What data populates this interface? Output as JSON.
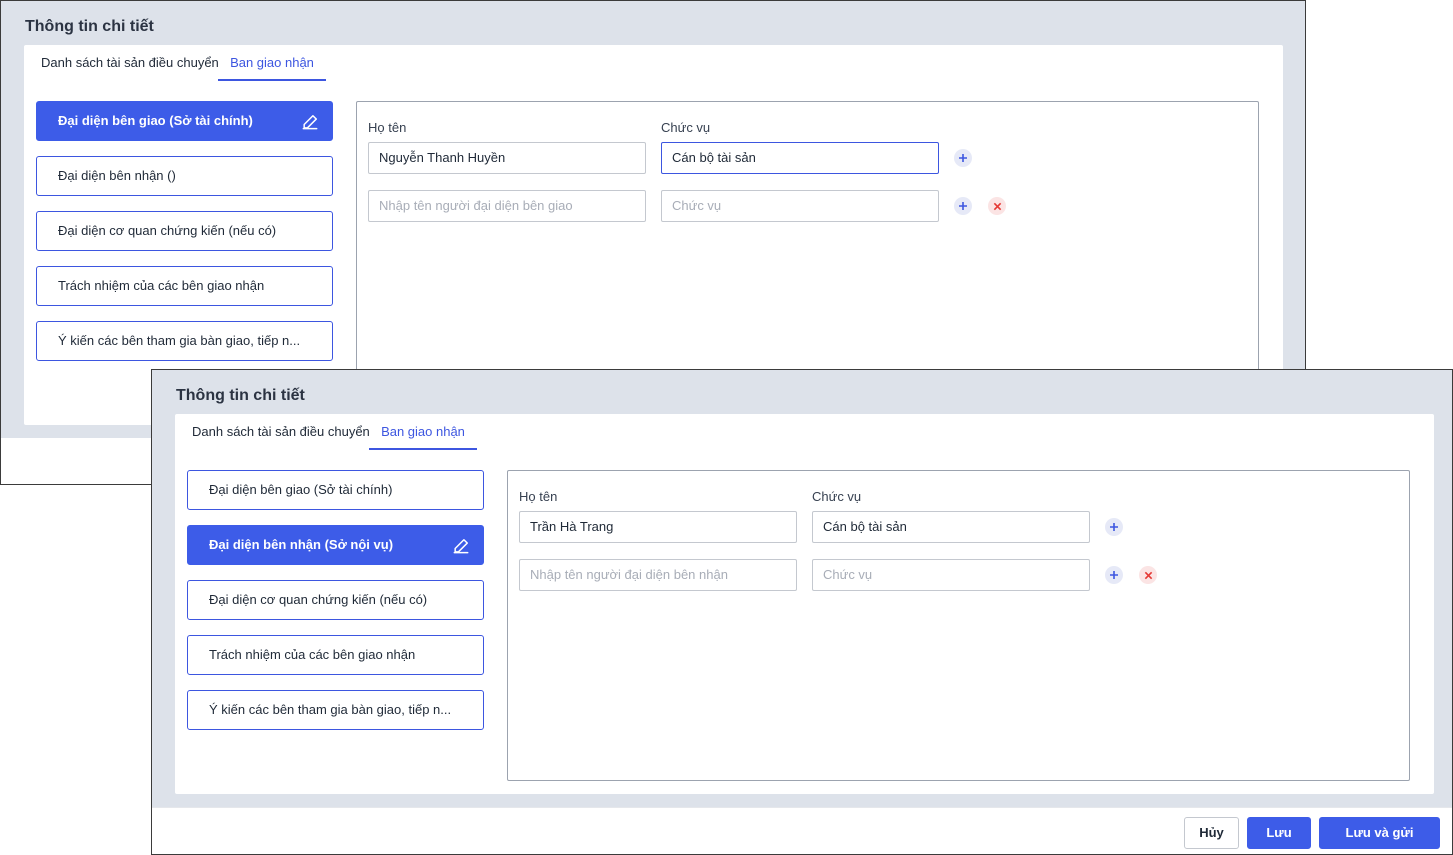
{
  "back": {
    "title": "Thông tin chi tiết",
    "tabs": [
      "Danh sách tài sản điều chuyển",
      "Ban giao nhận"
    ],
    "menu": [
      "Đại diện bên giao (Sở tài chính)",
      "Đại diện bên nhận ()",
      "Đại diện cơ quan chứng kiến (nếu có)",
      "Trách nhiệm của các bên giao nhận",
      "Ý kiến các bên tham gia bàn giao, tiếp n..."
    ],
    "label_name": "Họ tên",
    "label_position": "Chức vụ",
    "row1": {
      "name": "Nguyễn Thanh Huyền",
      "position": "Cán bộ tài sản"
    },
    "row2": {
      "name_placeholder": "Nhập tên người đại diện bên giao",
      "position_placeholder": "Chức vụ"
    }
  },
  "front": {
    "title": "Thông tin chi tiết",
    "tabs": [
      "Danh sách tài sản điều chuyển",
      "Ban giao nhận"
    ],
    "menu": [
      "Đại diện bên giao (Sở tài chính)",
      "Đại diện bên nhận (Sở nội vụ)",
      "Đại diện cơ quan chứng kiến (nếu có)",
      "Trách nhiệm của các bên giao nhận",
      "Ý kiến các bên tham gia bàn giao, tiếp n..."
    ],
    "label_name": "Họ tên",
    "label_position": "Chức vụ",
    "row1": {
      "name": "Trần Hà Trang",
      "position": "Cán bộ tài sản"
    },
    "row2": {
      "name_placeholder": "Nhập tên người đại diện bên nhận",
      "position_placeholder": "Chức vụ"
    },
    "footer": {
      "cancel": "Hủy",
      "save": "Lưu",
      "save_send": "Lưu và gửi"
    }
  },
  "colors": {
    "accent": "#3d5ce8",
    "panel_bg": "#dde2ea",
    "delete": "#e53935"
  },
  "icons": {
    "edit": "pencil-edit-icon",
    "add": "plus-icon",
    "remove": "close-icon"
  }
}
